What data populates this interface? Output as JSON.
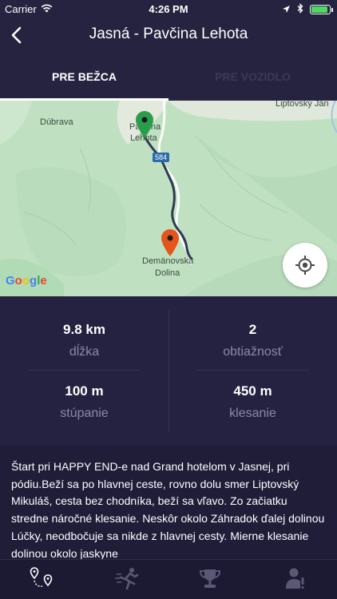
{
  "status_bar": {
    "carrier": "Carrier",
    "time": "4:26 PM",
    "battery_level": 0.9
  },
  "nav": {
    "title": "Jasná - Pavčina Lehota"
  },
  "tabs": [
    {
      "label": "PRE BEŽCA",
      "active": true
    },
    {
      "label": "PRE VOZIDLO",
      "active": false
    }
  ],
  "map": {
    "labels": {
      "dubrava": "Dúbrava",
      "pavcina_1": "Pavčina",
      "pavcina_2": "Lehota",
      "liptovsky_jan": "Liptovský Ján",
      "demanovska_1": "Demänovská",
      "demanovska_2": "Dolina",
      "road_number": "584"
    },
    "attribution": "Google",
    "start_pin_color": "#2a9d4c",
    "end_pin_color": "#e4541b",
    "route_color": "#2f3a56"
  },
  "stats": {
    "distance": {
      "value": "9.8 km",
      "label": "dĺžka"
    },
    "difficulty": {
      "value": "2",
      "label": "obtiažnosť"
    },
    "ascent": {
      "value": "100 m",
      "label": "stúpanie"
    },
    "descent": {
      "value": "450 m",
      "label": "klesanie"
    }
  },
  "description": "Štart pri HAPPY END-e nad Grand hotelom v Jasnej, pri pódiu.Beží sa po hlavnej ceste, rovno dolu smer Liptovský Mikuláš, cesta bez chodníka, beží sa vľavo. Zo začiatku stredne náročné klesanie. Neskôr okolo Záhradok ďalej dolinou Lúčky, neodbočuje sa nikde z hlavnej cesty. Mierne klesanie dolinou okolo jaskyne",
  "tab_bar": {
    "icons": [
      "route-icon",
      "runner-icon",
      "trophy-icon",
      "profile-icon"
    ],
    "active_color": "#ffffff",
    "inactive_color": "#5a5875"
  }
}
